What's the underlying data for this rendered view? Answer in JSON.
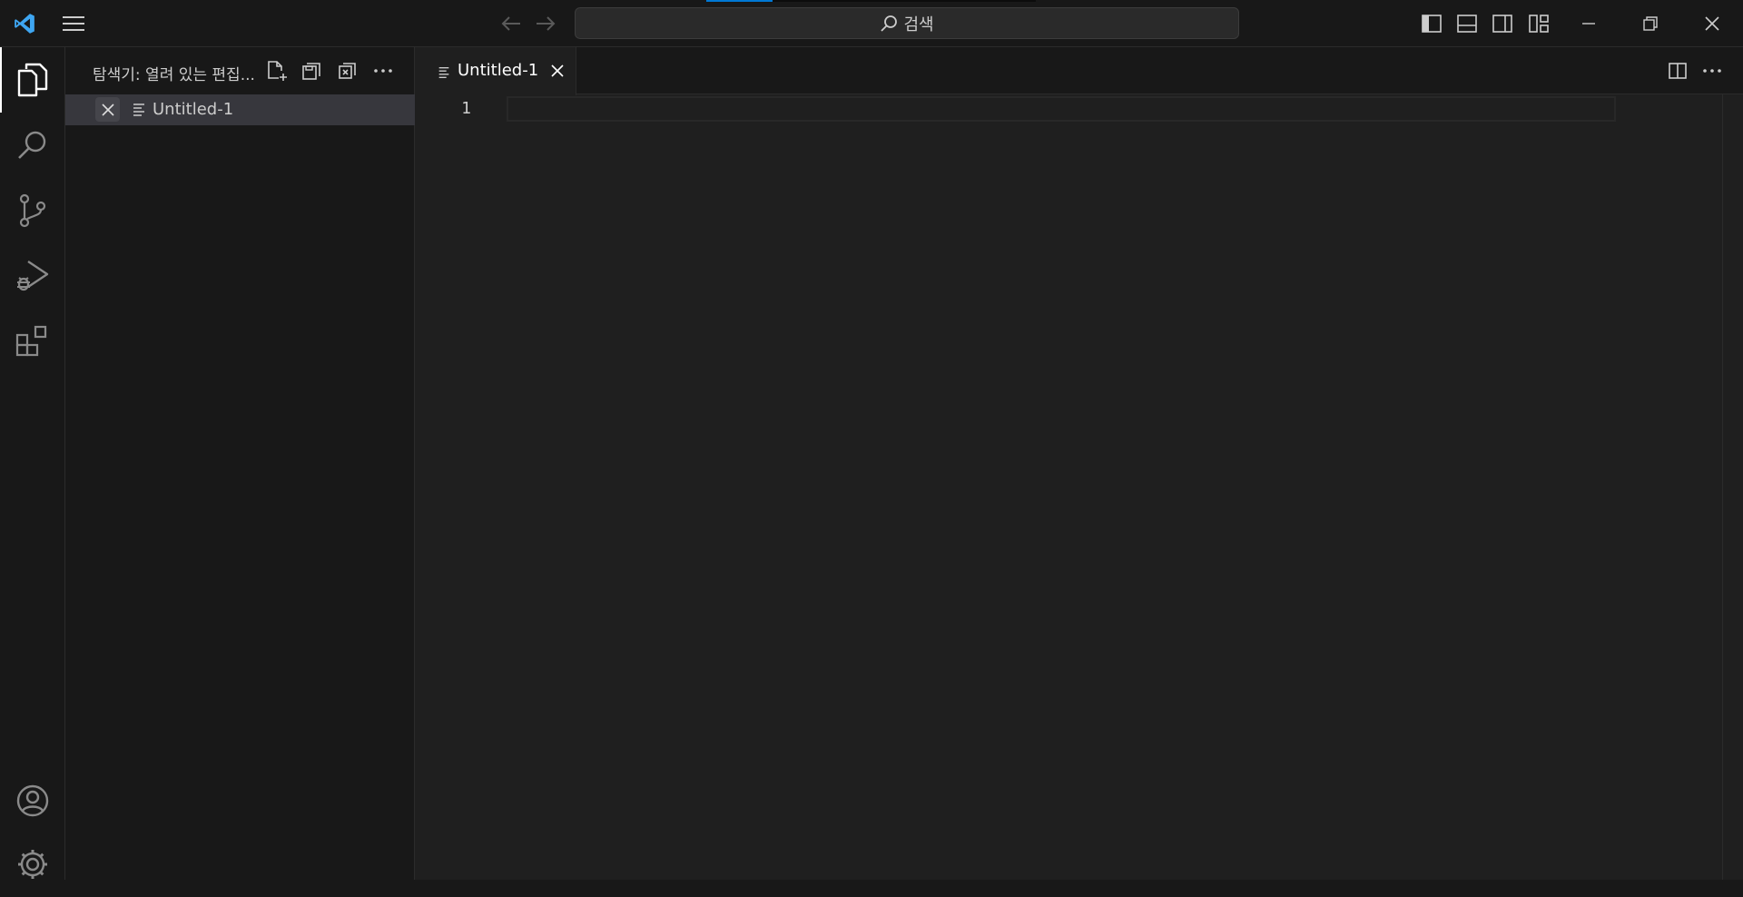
{
  "titlebar": {
    "search_label": "검색",
    "progress_fraction": 0.2
  },
  "activitybar": {
    "items": [
      "files-icon",
      "search-icon",
      "source-control-icon",
      "run-debug-icon",
      "extensions-icon"
    ],
    "bottom": [
      "account-icon",
      "settings-gear-icon"
    ]
  },
  "sidebar": {
    "title": "탐색기: 열려 있는 편집...",
    "open_editors": [
      {
        "label": "Untitled-1"
      }
    ]
  },
  "editor": {
    "tab_label": "Untitled-1",
    "line_numbers": [
      "1"
    ]
  },
  "colors": {
    "accent": "#0078d4",
    "vscode_logo": "#3ea6f2",
    "background": "#1f1f1f"
  }
}
